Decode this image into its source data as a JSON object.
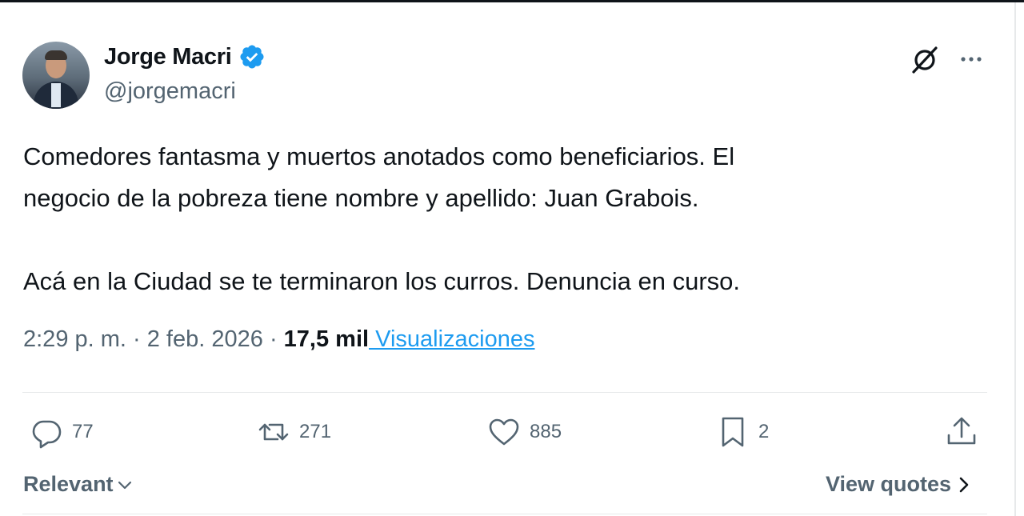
{
  "author": {
    "display_name": "Jorge Macri",
    "handle": "@jorgemacri",
    "verified": true,
    "verified_color": "#1d9bf0"
  },
  "tweet": {
    "line1": "Comedores fantasma y muertos anotados como beneficiarios. El",
    "line2": "negocio de la pobreza tiene nombre y apellido: Juan Grabois.",
    "line3": "Acá en la Ciudad se te terminaron los curros. Denuncia en curso."
  },
  "meta": {
    "time": "2:29 p. m.",
    "sep1": " · ",
    "date": "2 feb. 2026",
    "sep2": " · ",
    "views_count": "17,5 mil",
    "views_label": " Visualizaciones"
  },
  "actions": {
    "replies": "77",
    "reposts": "271",
    "likes": "885",
    "bookmarks": "2"
  },
  "footer": {
    "sort_label": "Relevant",
    "view_quotes_label": "View quotes"
  },
  "icons": {
    "grok": "grok-icon",
    "more": "more-icon",
    "reply": "reply-icon",
    "repost": "repost-icon",
    "like": "heart-icon",
    "bookmark": "bookmark-icon",
    "share": "share-icon"
  },
  "colors": {
    "text": "#0f1419",
    "secondary": "#536471",
    "accent": "#1d9bf0",
    "divider": "#e7e9ea"
  }
}
